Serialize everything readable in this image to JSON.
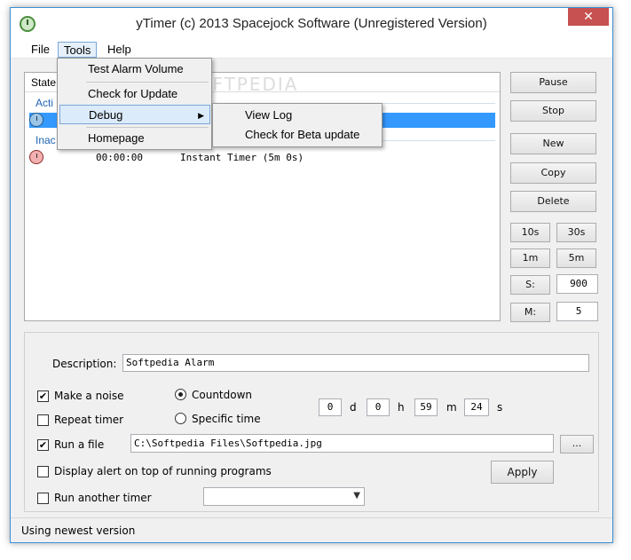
{
  "window": {
    "title": "yTimer (c) 2013 Spacejock Software (Unregistered Version)",
    "close_label": "✕"
  },
  "menu": {
    "file": "File",
    "tools": "Tools",
    "help": "Help"
  },
  "tools_menu": {
    "items": [
      "Test Alarm Volume",
      "Check for Update",
      "Debug",
      "Homepage"
    ],
    "debug_arrow": "▶"
  },
  "debug_submenu": {
    "items": [
      "View Log",
      "Check for Beta update"
    ]
  },
  "list": {
    "header_state": "State",
    "active_group": "Acti",
    "inactive_group": "Inac",
    "inactive_row": {
      "time": "00:00:00",
      "name": "Instant Timer (5m 0s)"
    }
  },
  "watermark": "SOFTPEDIA",
  "buttons": {
    "pause": "Pause",
    "stop": "Stop",
    "new": "New",
    "copy": "Copy",
    "delete": "Delete",
    "s10": "10s",
    "s30": "30s",
    "m1": "1m",
    "m5": "5m",
    "s_label": "S:",
    "m_label": "M:",
    "browse": "...",
    "apply": "Apply"
  },
  "fields": {
    "s_value": "900",
    "m_value": "5"
  },
  "form": {
    "description_label": "Description:",
    "description_value": "Softpedia Alarm",
    "make_noise": "Make a noise",
    "repeat_timer": "Repeat timer",
    "run_file": "Run a file",
    "display_alert": "Display alert on top of running programs",
    "run_another": "Run another timer",
    "countdown": "Countdown",
    "specific_time": "Specific time",
    "file_path": "C:\\Softpedia Files\\Softpedia.jpg",
    "days": "0",
    "days_unit": "d",
    "hours": "0",
    "hours_unit": "h",
    "minutes": "59",
    "minutes_unit": "m",
    "seconds": "24",
    "seconds_unit": "s",
    "check_mark": "✔"
  },
  "status": {
    "text": "Using newest version"
  },
  "colors": {
    "selection": "#3399ff",
    "close": "#c75050",
    "group_label": "#1e63b4"
  }
}
